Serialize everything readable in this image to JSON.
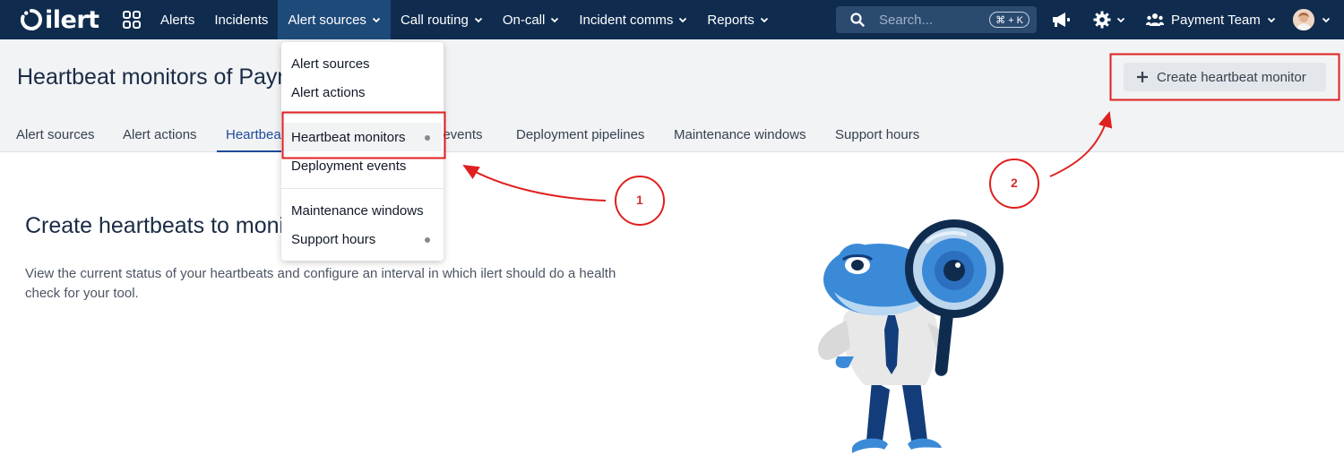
{
  "brand": {
    "name": "ilert"
  },
  "nav": {
    "items": [
      {
        "label": "Alerts"
      },
      {
        "label": "Incidents"
      },
      {
        "label": "Alert sources"
      },
      {
        "label": "Call routing"
      },
      {
        "label": "On-call"
      },
      {
        "label": "Incident comms"
      },
      {
        "label": "Reports"
      }
    ],
    "search_placeholder": "Search...",
    "search_shortcut": "⌘ + K",
    "team_label": "Payment Team"
  },
  "header": {
    "title": "Heartbeat monitors of Paym",
    "create_button_label": "Create heartbeat monitor",
    "tabs": [
      {
        "label": "Alert sources"
      },
      {
        "label": "Alert actions"
      },
      {
        "label": "Heartbea"
      },
      {
        "label": "t events"
      },
      {
        "label": "Deployment pipelines"
      },
      {
        "label": "Maintenance windows"
      },
      {
        "label": "Support hours"
      }
    ]
  },
  "empty_state": {
    "headline": "Create heartbeats to monit",
    "description": "View the current status of your heartbeats and configure an interval in which ilert should do a health check for your tool."
  },
  "dropdown": {
    "items": [
      {
        "label": "Alert sources"
      },
      {
        "label": "Alert actions"
      },
      {
        "label": "Heartbeat monitors"
      },
      {
        "label": "Deployment events"
      },
      {
        "label": "Maintenance windows"
      },
      {
        "label": "Support hours"
      }
    ]
  },
  "annotations": {
    "step1": "1",
    "step2": "2",
    "color": "#e02020"
  },
  "colors": {
    "nav_bg": "#0f2c4f",
    "accent": "#1e4a9a"
  }
}
